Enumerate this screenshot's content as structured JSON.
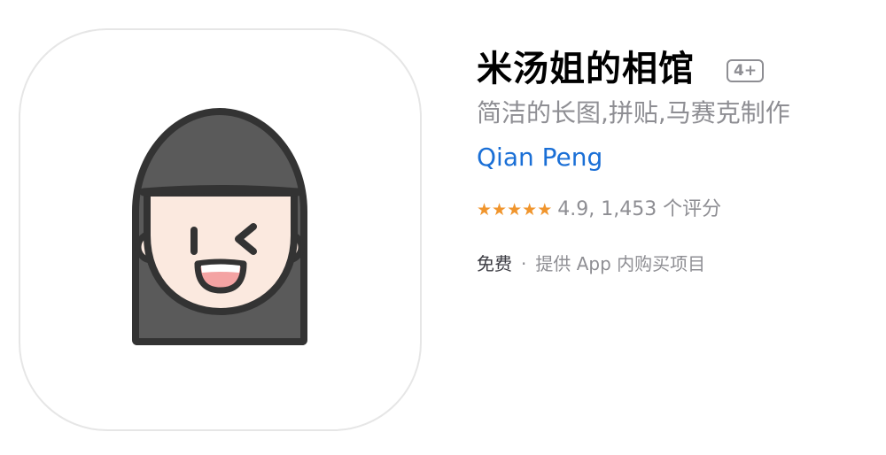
{
  "app": {
    "title": "米汤姐的相馆",
    "age_rating": "4+",
    "subtitle": "简洁的长图,拼贴,马赛克制作",
    "developer": "Qian Peng",
    "rating": {
      "stars_filled": 5,
      "stars_total": 5,
      "text": "4.9, 1,453 个评分"
    },
    "price": "免费",
    "separator": "·",
    "in_app_purchase": "提供 App 内购买项目",
    "icon_name": "winking-girl-icon"
  },
  "colors": {
    "accent_link": "#1a6fd6",
    "star": "#f0952d",
    "secondary_text": "#8e8e93",
    "hair": "#5a5a5a",
    "outline": "#333333",
    "skin": "#fbe9df",
    "mouth": "#f4a3a3"
  }
}
